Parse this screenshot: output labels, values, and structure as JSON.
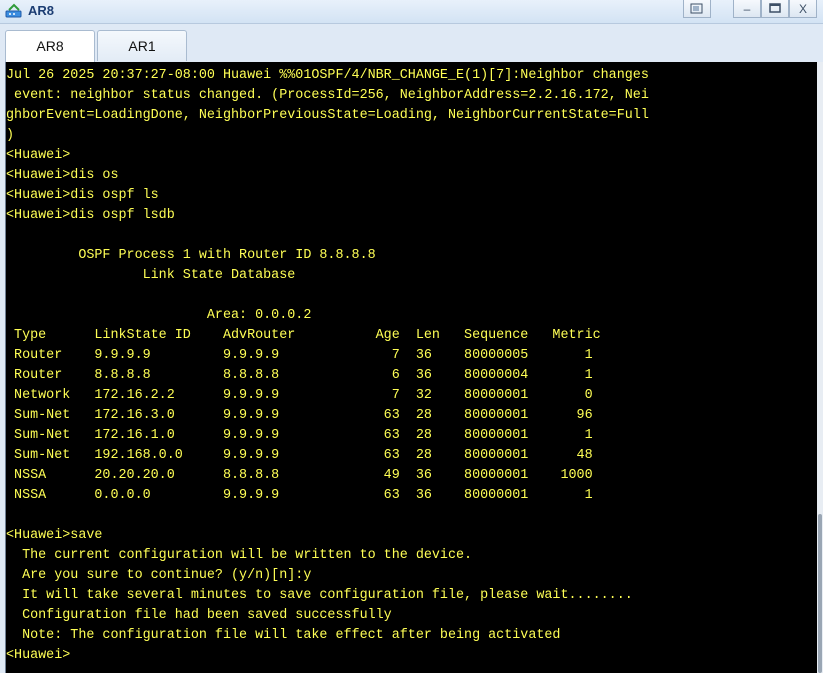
{
  "window": {
    "title": "AR8",
    "icon": "router-app-icon",
    "controls": {
      "restore_icon": "restore-icon",
      "minimize_label": "–",
      "maximize_icon": "maximize-icon",
      "close_label": "X"
    }
  },
  "tabs": [
    {
      "label": "AR8",
      "active": true
    },
    {
      "label": "AR1",
      "active": false
    }
  ],
  "terminal": {
    "lines": [
      "Jul 26 2025 20:37:27-08:00 Huawei %%01OSPF/4/NBR_CHANGE_E(1)[7]:Neighbor changes",
      " event: neighbor status changed. (ProcessId=256, NeighborAddress=2.2.16.172, Nei",
      "ghborEvent=LoadingDone, NeighborPreviousState=Loading, NeighborCurrentState=Full",
      ")",
      "<Huawei>",
      "<Huawei>dis os",
      "<Huawei>dis ospf ls",
      "<Huawei>dis ospf lsdb",
      "",
      "\t OSPF Process 1 with Router ID 8.8.8.8",
      "\t\t Link State Database",
      "",
      "\t\t         Area: 0.0.0.2",
      " Type      LinkState ID    AdvRouter          Age  Len   Sequence   Metric",
      " Router    9.9.9.9         9.9.9.9              7  36    80000005       1",
      " Router    8.8.8.8         8.8.8.8              6  36    80000004       1",
      " Network   172.16.2.2      9.9.9.9              7  32    80000001       0",
      " Sum-Net   172.16.3.0      9.9.9.9             63  28    80000001      96",
      " Sum-Net   172.16.1.0      9.9.9.9             63  28    80000001       1",
      " Sum-Net   192.168.0.0     9.9.9.9             63  28    80000001      48",
      " NSSA      20.20.20.0      8.8.8.8             49  36    80000001    1000",
      " NSSA      0.0.0.0         9.9.9.9             63  36    80000001       1",
      "",
      "<Huawei>save",
      "  The current configuration will be written to the device.",
      "  Are you sure to continue? (y/n)[n]:y",
      "  It will take several minutes to save configuration file, please wait........",
      "  Configuration file had been saved successfully",
      "  Note: The configuration file will take effect after being activated",
      "<Huawei>"
    ]
  },
  "colors": {
    "terminal_bg": "#000000",
    "terminal_fg": "#ffff55",
    "title_fg": "#1c3d73"
  }
}
